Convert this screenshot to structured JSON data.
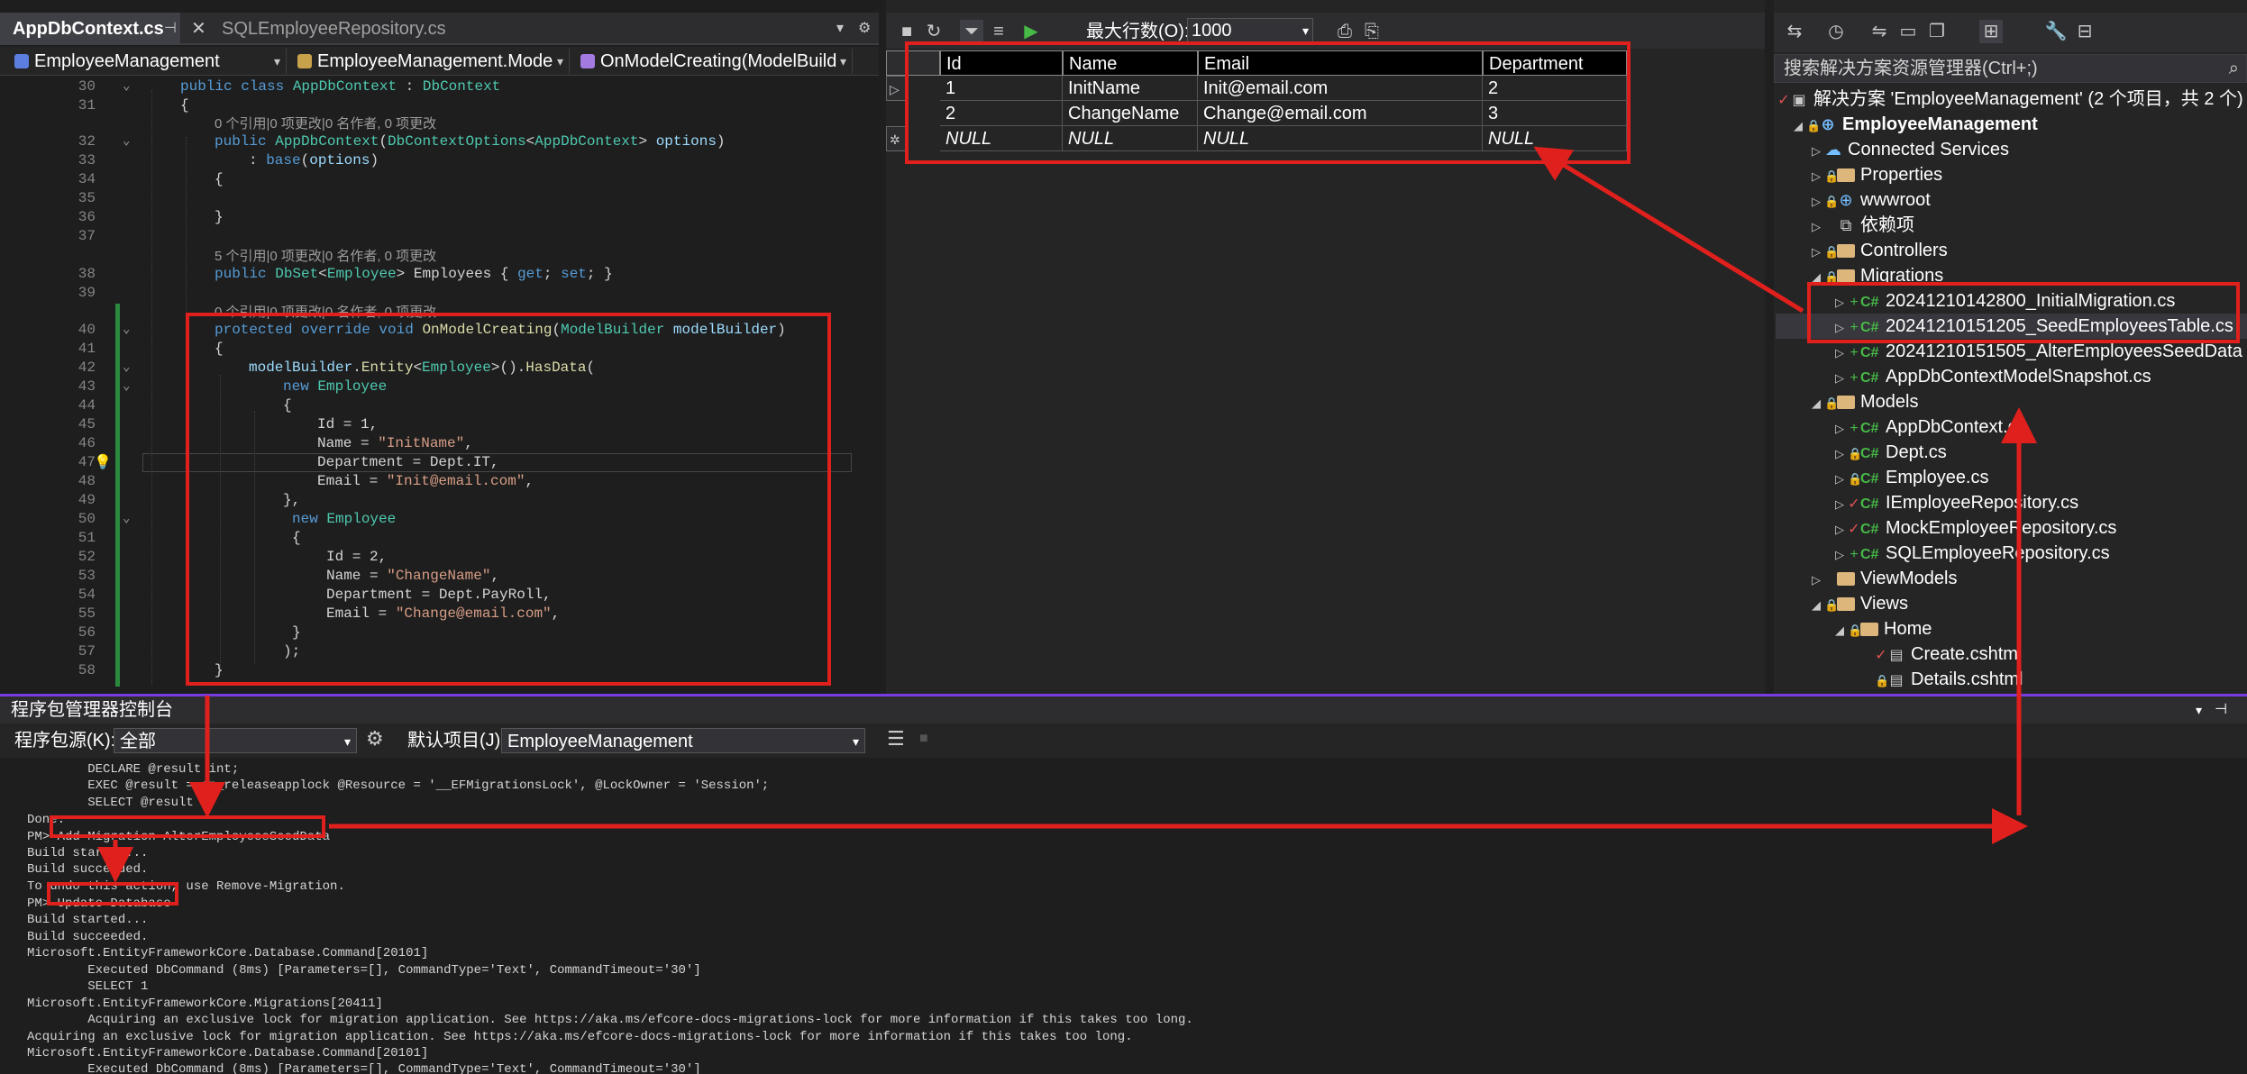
{
  "editor": {
    "tabs": [
      {
        "label": "AppDbContext.cs",
        "active": true
      },
      {
        "label": "SQLEmployeeRepository.cs",
        "active": false
      }
    ],
    "nav": {
      "project": "EmployeeManagement",
      "namespace": "EmployeeManagement.Mode",
      "member": "OnModelCreating(ModelBuild"
    },
    "lines": [
      {
        "n": "30",
        "text": "public class AppDbContext : DbContext"
      },
      {
        "n": "31",
        "text": "{"
      },
      {
        "n": "",
        "text": "0 个引用|0 项更改|0 名作者, 0 项更改"
      },
      {
        "n": "32",
        "text": "public AppDbContext(DbContextOptions<AppDbContext> options)"
      },
      {
        "n": "33",
        "text": ": base(options)"
      },
      {
        "n": "34",
        "text": "{"
      },
      {
        "n": "35",
        "text": ""
      },
      {
        "n": "36",
        "text": "}"
      },
      {
        "n": "37",
        "text": ""
      },
      {
        "n": "",
        "text": "5 个引用|0 项更改|0 名作者, 0 项更改"
      },
      {
        "n": "38",
        "text": "public DbSet<Employee> Employees { get; set; }"
      },
      {
        "n": "39",
        "text": ""
      },
      {
        "n": "",
        "text": "0 个引用|0 项更改|0 名作者, 0 项更改"
      },
      {
        "n": "40",
        "text": "protected override void OnModelCreating(ModelBuilder modelBuilder)"
      },
      {
        "n": "41",
        "text": "{"
      },
      {
        "n": "42",
        "text": "modelBuilder.Entity<Employee>().HasData("
      },
      {
        "n": "43",
        "text": "new Employee"
      },
      {
        "n": "44",
        "text": "{"
      },
      {
        "n": "45",
        "text": "Id = 1,"
      },
      {
        "n": "46",
        "text": "Name = \"InitName\","
      },
      {
        "n": "47",
        "text": "Department = Dept.IT,"
      },
      {
        "n": "48",
        "text": "Email = \"Init@email.com\","
      },
      {
        "n": "49",
        "text": "},"
      },
      {
        "n": "50",
        "text": "new Employee"
      },
      {
        "n": "51",
        "text": "{"
      },
      {
        "n": "52",
        "text": "Id = 2,"
      },
      {
        "n": "53",
        "text": "Name = \"ChangeName\","
      },
      {
        "n": "54",
        "text": "Department = Dept.PayRoll,"
      },
      {
        "n": "55",
        "text": "Email = \"Change@email.com\","
      },
      {
        "n": "56",
        "text": "}"
      },
      {
        "n": "57",
        "text": ");"
      },
      {
        "n": "58",
        "text": "}"
      }
    ]
  },
  "grid": {
    "max_rows_label": "最大行数(O):",
    "max_rows_value": "1000",
    "columns": [
      "Id",
      "Name",
      "Email",
      "Department"
    ],
    "rows": [
      [
        "1",
        "InitName",
        "Init@email.com",
        "2"
      ],
      [
        "2",
        "ChangeName",
        "Change@email.com",
        "3"
      ],
      [
        "NULL",
        "NULL",
        "NULL",
        "NULL"
      ]
    ]
  },
  "solution": {
    "search_placeholder": "搜索解决方案资源管理器(Ctrl+;)",
    "root": "解决方案 'EmployeeManagement' (2 个项目，共 2 个)",
    "project": "EmployeeManagement",
    "items": [
      {
        "label": "Connected Services",
        "depth": 2,
        "icon": "connected-services-icon"
      },
      {
        "label": "Properties",
        "depth": 2,
        "icon": "folder-icon"
      },
      {
        "label": "wwwroot",
        "depth": 2,
        "icon": "globe-icon"
      },
      {
        "label": "依赖项",
        "depth": 2,
        "icon": "dependencies-icon"
      },
      {
        "label": "Controllers",
        "depth": 2,
        "icon": "folder-icon"
      },
      {
        "label": "Migrations",
        "depth": 2,
        "icon": "folder-icon"
      },
      {
        "label": "20241210142800_InitialMigration.cs",
        "depth": 3,
        "icon": "csharp-icon"
      },
      {
        "label": "20241210151205_SeedEmployeesTable.cs",
        "depth": 3,
        "icon": "csharp-icon"
      },
      {
        "label": "20241210151505_AlterEmployeesSeedData",
        "depth": 3,
        "icon": "csharp-icon"
      },
      {
        "label": "AppDbContextModelSnapshot.cs",
        "depth": 3,
        "icon": "csharp-icon"
      },
      {
        "label": "Models",
        "depth": 2,
        "icon": "folder-icon"
      },
      {
        "label": "AppDbContext.cs",
        "depth": 3,
        "icon": "csharp-icon"
      },
      {
        "label": "Dept.cs",
        "depth": 3,
        "icon": "csharp-icon"
      },
      {
        "label": "Employee.cs",
        "depth": 3,
        "icon": "csharp-icon"
      },
      {
        "label": "IEmployeeRepository.cs",
        "depth": 3,
        "icon": "csharp-icon"
      },
      {
        "label": "MockEmployeeRepository.cs",
        "depth": 3,
        "icon": "csharp-icon"
      },
      {
        "label": "SQLEmployeeRepository.cs",
        "depth": 3,
        "icon": "csharp-icon"
      },
      {
        "label": "ViewModels",
        "depth": 2,
        "icon": "folder-icon"
      },
      {
        "label": "Views",
        "depth": 2,
        "icon": "folder-icon"
      },
      {
        "label": "Home",
        "depth": 3,
        "icon": "folder-icon"
      },
      {
        "label": "Create.cshtml",
        "depth": 4,
        "icon": "razor-file-icon"
      },
      {
        "label": "Details.cshtml",
        "depth": 4,
        "icon": "razor-file-icon"
      }
    ]
  },
  "pmc": {
    "title": "程序包管理器控制台",
    "source_label": "程序包源(K):",
    "source_value": "全部",
    "default_project_label": "默认项目(J):",
    "default_project_value": "EmployeeManagement",
    "lines": [
      "        DECLARE @result int;",
      "        EXEC @result = sp_releaseapplock @Resource = '__EFMigrationsLock', @LockOwner = 'Session';",
      "        SELECT @result",
      "Done.",
      "PM> Add-Migration AlterEmployeesSeedData",
      "Build started...",
      "Build succeeded.",
      "To undo this action, use Remove-Migration.",
      "PM> Update-Database",
      "Build started...",
      "Build succeeded.",
      "Microsoft.EntityFrameworkCore.Database.Command[20101]",
      "        Executed DbCommand (8ms) [Parameters=[], CommandType='Text', CommandTimeout='30']",
      "        SELECT 1",
      "Microsoft.EntityFrameworkCore.Migrations[20411]",
      "        Acquiring an exclusive lock for migration application. See https://aka.ms/efcore-docs-migrations-lock for more information if this takes too long.",
      "Acquiring an exclusive lock for migration application. See https://aka.ms/efcore-docs-migrations-lock for more information if this takes too long.",
      "Microsoft.EntityFrameworkCore.Database.Command[20101]",
      "        Executed DbCommand (8ms) [Parameters=[], CommandType='Text', CommandTimeout='30']"
    ]
  },
  "colors": {
    "highlight": "#e0201c",
    "accent": "#7a3ce0",
    "change_bar": "#2b8a3e"
  }
}
